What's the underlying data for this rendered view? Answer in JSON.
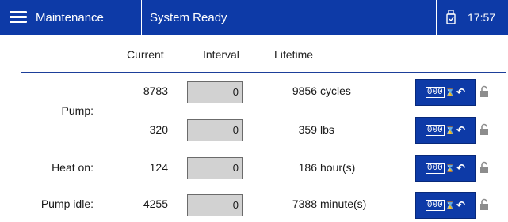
{
  "header": {
    "menu_label": "Maintenance",
    "status": "System Ready",
    "time": "17:57",
    "accent": "#0d3aa7"
  },
  "columns": {
    "current": "Current",
    "interval": "Interval",
    "lifetime": "Lifetime"
  },
  "rows": [
    {
      "current": "8783",
      "interval": "0",
      "lifetime": "9856",
      "unit": "cycles"
    },
    {
      "current": "320",
      "interval": "0",
      "lifetime": "359",
      "unit": "lbs"
    },
    {
      "current": "124",
      "interval": "0",
      "lifetime": "186",
      "unit": "hour(s)"
    },
    {
      "current": "4255",
      "interval": "0",
      "lifetime": "7388",
      "unit": "minute(s)"
    }
  ],
  "groups": {
    "pump": "Pump:",
    "heat_on": "Heat on:",
    "pump_idle": "Pump idle:"
  },
  "reset_button": {
    "digits": "000",
    "icon": "hourglass-reset-icon"
  },
  "lock_icon": "padlock-icon"
}
